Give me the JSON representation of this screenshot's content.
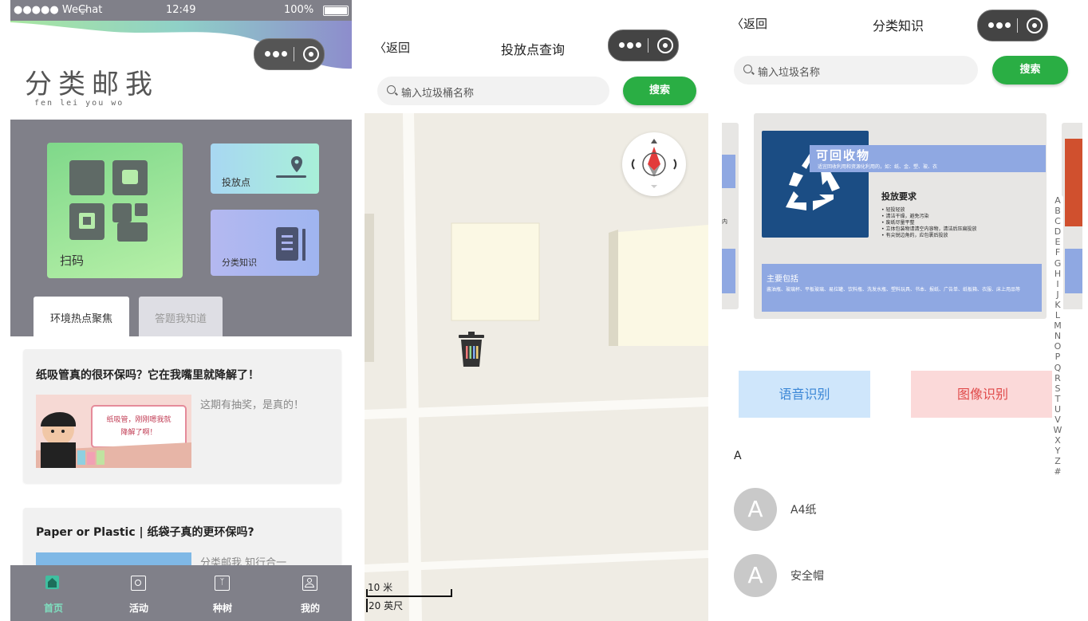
{
  "screen1": {
    "status": {
      "carrier": "●●●●● WeChat",
      "time": "12:49",
      "battery": "100%"
    },
    "brand": {
      "title": "分类邮我",
      "pinyin": "fen lei you wo"
    },
    "cards": {
      "scan": "扫码",
      "drop_point": "投放点",
      "knowledge": "分类知识"
    },
    "tabs": {
      "active": "环境热点聚焦",
      "inactive": "答题我知道"
    },
    "articles": [
      {
        "title": "纸吸管真的很环保吗？它在我嘴里就降解了！",
        "desc": "这期有抽奖，是真的！",
        "image_text": "纸吸管，刚刚嗯我就降解了啊！"
      },
      {
        "title": "Paper or Plastic | 纸袋子真的更环保吗?",
        "desc": "分类邮我 知行合一"
      }
    ],
    "tabbar": [
      "首页",
      "活动",
      "种树",
      "我的"
    ]
  },
  "screen2": {
    "back": "返回",
    "title": "投放点查询",
    "search_placeholder": "输入垃圾桶名称",
    "search_button": "搜索",
    "scale": {
      "metric": "10 米",
      "imperial": "20 英尺"
    }
  },
  "screen3": {
    "back": "返回",
    "title": "分类知识",
    "search_placeholder": "输入垃圾名称",
    "search_button": "搜索",
    "banner": {
      "title": "可回收物",
      "subtitle": "适宜回收利用和资源化利用的，如：纸、金、塑、玻、衣",
      "req_title": "投放要求",
      "requirements": [
        "• 轻投轻放",
        "• 清洁干燥，避免污染",
        "• 废纸尽量平整",
        "• 立体包装物请清空内容物，清洁后压扁投放",
        "• 有尖锐边角的，应包裹后投放"
      ],
      "main_title": "主要包括",
      "main_items": "酱油瓶、玻璃杯、平板玻璃、易拉罐、饮料瓶、洗发水瓶、塑料玩具、书本、报纸、广告单、纸板箱、衣服、床上用品等",
      "left_peek": "内"
    },
    "buttons": {
      "voice": "语音识别",
      "image": "图像识别"
    },
    "section": "A",
    "items": [
      {
        "avatar": "A",
        "name": "A4纸"
      },
      {
        "avatar": "A",
        "name": "安全帽"
      }
    ],
    "alphabet": [
      "A",
      "B",
      "C",
      "D",
      "E",
      "F",
      "G",
      "H",
      "I",
      "J",
      "K",
      "L",
      "M",
      "N",
      "O",
      "P",
      "Q",
      "R",
      "S",
      "T",
      "U",
      "V",
      "W",
      "X",
      "Y",
      "Z",
      "#"
    ]
  },
  "icons": {
    "capsule_menu": "more-dots-icon",
    "capsule_close": "target-circle-icon",
    "qr": "qr-code-icon",
    "location": "location-pin-icon",
    "book": "book-icon",
    "trash": "trash-bin-icon",
    "compass": "compass-icon",
    "recycle": "recycle-icon"
  },
  "colors": {
    "header_grey": "#808089",
    "search_green": "#2aae44",
    "recycle_blue": "#1b4d84",
    "voice_bg": "#cfe6fb",
    "image_bg": "#fbd9d9"
  }
}
